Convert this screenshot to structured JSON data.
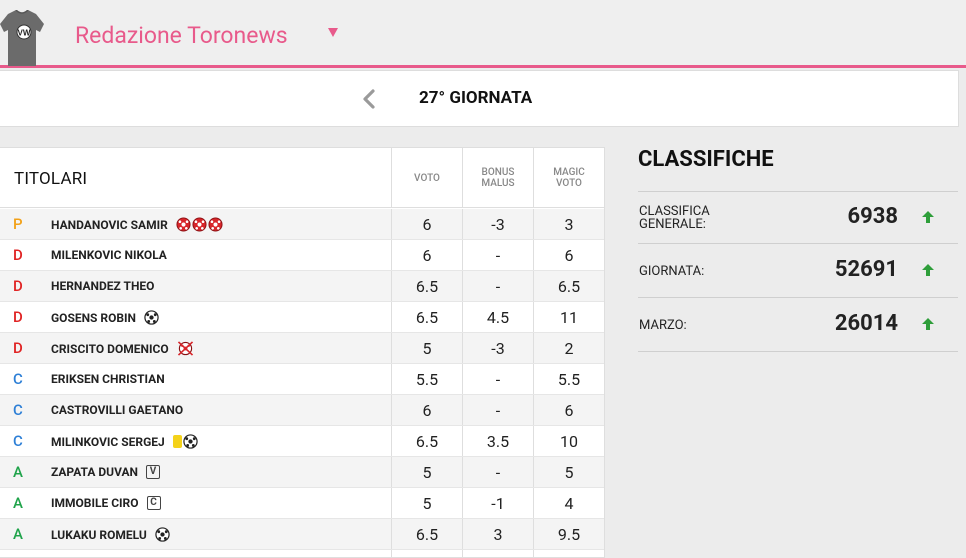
{
  "header": {
    "team_name": "Redazione Toronews"
  },
  "round": {
    "label": "27° GIORNATA"
  },
  "table": {
    "header": {
      "titolari": "TITOLARI",
      "voto": "VOTO",
      "bonus_malus_1": "BONUS",
      "bonus_malus_2": "MALUS",
      "magic_voto_1": "MAGIC",
      "magic_voto_2": "VOTO"
    },
    "rows": [
      {
        "role": "P",
        "name": "HANDANOVIC SAMIR",
        "voto": "6",
        "bonus": "-3",
        "magic": "3"
      },
      {
        "role": "D",
        "name": "MILENKOVIC NIKOLA",
        "voto": "6",
        "bonus": "-",
        "magic": "6"
      },
      {
        "role": "D",
        "name": "HERNANDEZ THEO",
        "voto": "6.5",
        "bonus": "-",
        "magic": "6.5"
      },
      {
        "role": "D",
        "name": "GOSENS ROBIN",
        "voto": "6.5",
        "bonus": "4.5",
        "magic": "11"
      },
      {
        "role": "D",
        "name": "CRISCITO DOMENICO",
        "voto": "5",
        "bonus": "-3",
        "magic": "2"
      },
      {
        "role": "C",
        "name": "ERIKSEN CHRISTIAN",
        "voto": "5.5",
        "bonus": "-",
        "magic": "5.5"
      },
      {
        "role": "C",
        "name": "CASTROVILLI GAETANO",
        "voto": "6",
        "bonus": "-",
        "magic": "6"
      },
      {
        "role": "C",
        "name": "MILINKOVIC SERGEJ",
        "voto": "6.5",
        "bonus": "3.5",
        "magic": "10"
      },
      {
        "role": "A",
        "name": "ZAPATA DUVAN",
        "voto": "5",
        "bonus": "-",
        "magic": "5"
      },
      {
        "role": "A",
        "name": "IMMOBILE CIRO",
        "voto": "5",
        "bonus": "-1",
        "magic": "4"
      },
      {
        "role": "A",
        "name": "LUKAKU ROMELU",
        "voto": "6.5",
        "bonus": "3",
        "magic": "9.5"
      }
    ],
    "badges": {
      "captain_letter": "C",
      "vice_letter": "V"
    }
  },
  "classifiche": {
    "title": "CLASSIFICHE",
    "generale_label_1": "CLASSIFICA",
    "generale_label_2": "GENERALE:",
    "generale_value": "6938",
    "giornata_label": "GIORNATA:",
    "giornata_value": "52691",
    "marzo_label": "MARZO:",
    "marzo_value": "26014"
  },
  "colors": {
    "accent": "#e85a8b",
    "role_P": "#f2a118",
    "role_D": "#e02424",
    "role_C": "#2d7fd6",
    "role_A": "#1fa34a",
    "up_arrow": "#2e9e3a"
  }
}
